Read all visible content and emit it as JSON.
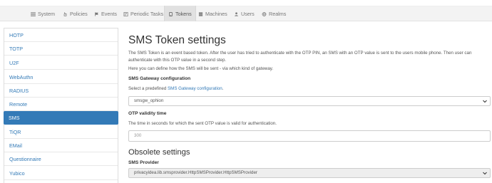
{
  "nav": {
    "items": [
      {
        "label": "System",
        "icon": "system-icon"
      },
      {
        "label": "Policies",
        "icon": "policies-icon"
      },
      {
        "label": "Events",
        "icon": "events-icon"
      },
      {
        "label": "Periodic Tasks",
        "icon": "periodic-tasks-icon"
      },
      {
        "label": "Tokens",
        "icon": "tokens-icon"
      },
      {
        "label": "Machines",
        "icon": "machines-icon"
      },
      {
        "label": "Users",
        "icon": "users-icon"
      },
      {
        "label": "Realms",
        "icon": "realms-icon"
      }
    ],
    "active": "Tokens"
  },
  "sidebar": {
    "items": [
      {
        "label": "HOTP"
      },
      {
        "label": "TOTP"
      },
      {
        "label": "U2F"
      },
      {
        "label": "WebAuthn"
      },
      {
        "label": "RADIUS"
      },
      {
        "label": "Remote"
      },
      {
        "label": "SMS"
      },
      {
        "label": "TiQR"
      },
      {
        "label": "EMail"
      },
      {
        "label": "Questionnaire"
      },
      {
        "label": "Yubico"
      }
    ],
    "active": "SMS"
  },
  "main": {
    "title": "SMS Token settings",
    "description": "The SMS Token is an event based token. After the user has tried to authenticate with the OTP PIN, an SMS with an OTP value is sent to the users mobile phone. Then user can authenticate with this OTP value in a second step.",
    "define_text": "Here you can define how the SMS will be sent - via which kind of gateway.",
    "gateway": {
      "heading": "SMS Gateway configuration",
      "select_prefix": "Select a predefined ",
      "link_text": "SMS Gateway configuration",
      "select_suffix": ".",
      "selected_value": "smsgw_ophion"
    },
    "validity": {
      "heading": "OTP validity time",
      "help": "The time in seconds for which the sent OTP value is valid for authentication.",
      "value": "300"
    },
    "obsolete": {
      "heading": "Obsolete settings",
      "provider_label": "SMS Provider",
      "provider_value": "privacyidea.lib.smsprovider.HttpSMSProvider.HttpSMSProvider"
    }
  },
  "colors": {
    "accent": "#337ab7",
    "nav_bg": "#f3f3f3",
    "active_nav_bg": "#e1e1e1"
  }
}
